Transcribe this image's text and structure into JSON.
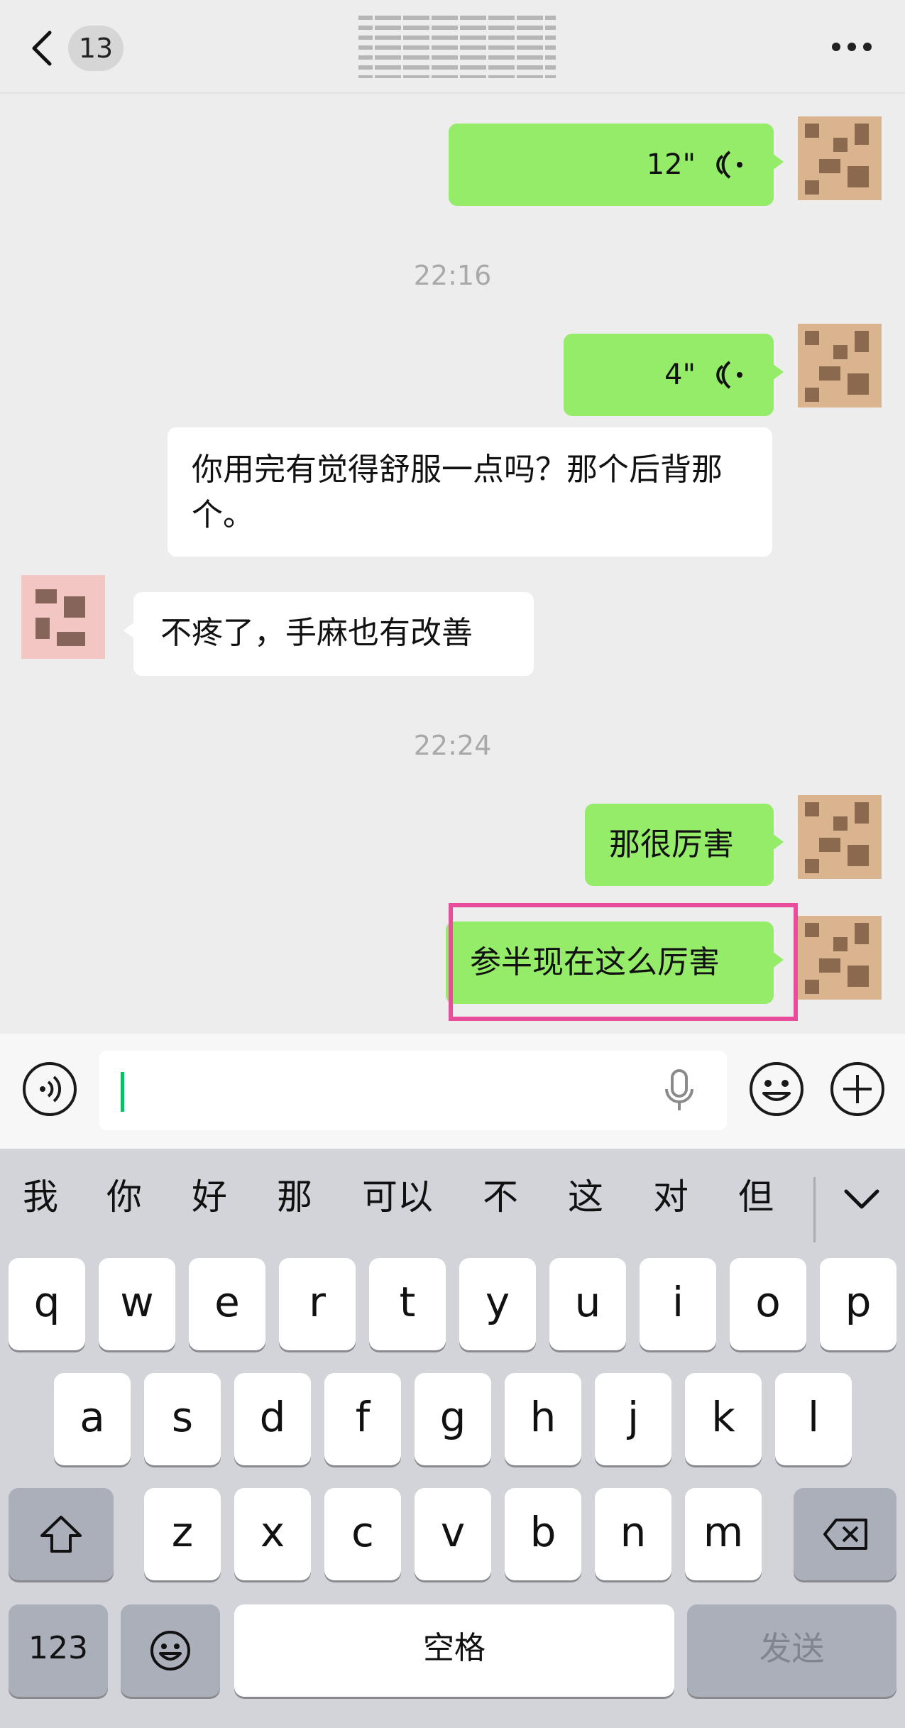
{
  "header": {
    "unread_count": "13"
  },
  "chat": {
    "timestamps": [
      "22:16",
      "22:24"
    ],
    "messages": [
      {
        "side": "out",
        "type": "voice",
        "duration": "12\""
      },
      {
        "side": "out",
        "type": "voice",
        "duration": "4\""
      },
      {
        "side": "in",
        "type": "text",
        "text": "你用完有觉得舒服一点吗？那个后背那个。"
      },
      {
        "side": "in",
        "type": "text",
        "text": "不疼了，手麻也有改善"
      },
      {
        "side": "out",
        "type": "text",
        "text": "那很厉害"
      },
      {
        "side": "out",
        "type": "text",
        "text": "参半现在这么厉害",
        "highlighted": true
      }
    ]
  },
  "input": {
    "value": ""
  },
  "keyboard": {
    "candidates": [
      "我",
      "你",
      "好",
      "那",
      "可以",
      "不",
      "这",
      "对",
      "但"
    ],
    "row1": [
      "q",
      "w",
      "e",
      "r",
      "t",
      "y",
      "u",
      "i",
      "o",
      "p"
    ],
    "row2": [
      "a",
      "s",
      "d",
      "f",
      "g",
      "h",
      "j",
      "k",
      "l"
    ],
    "row3": [
      "z",
      "x",
      "c",
      "v",
      "b",
      "n",
      "m"
    ],
    "numbers_label": "123",
    "space_label": "空格",
    "send_label": "发送"
  },
  "colors": {
    "outgoing_bubble": "#95ec69",
    "incoming_bubble": "#ffffff",
    "chat_background": "#ededed",
    "highlight_border": "#ea4c9c",
    "caret": "#07c160"
  },
  "icons": [
    "back-chevron-icon",
    "more-icon",
    "voice-wave-icon",
    "voice-input-icon",
    "microphone-icon",
    "emoji-icon",
    "plus-icon",
    "shift-icon",
    "backspace-icon",
    "collapse-chevron-icon"
  ]
}
